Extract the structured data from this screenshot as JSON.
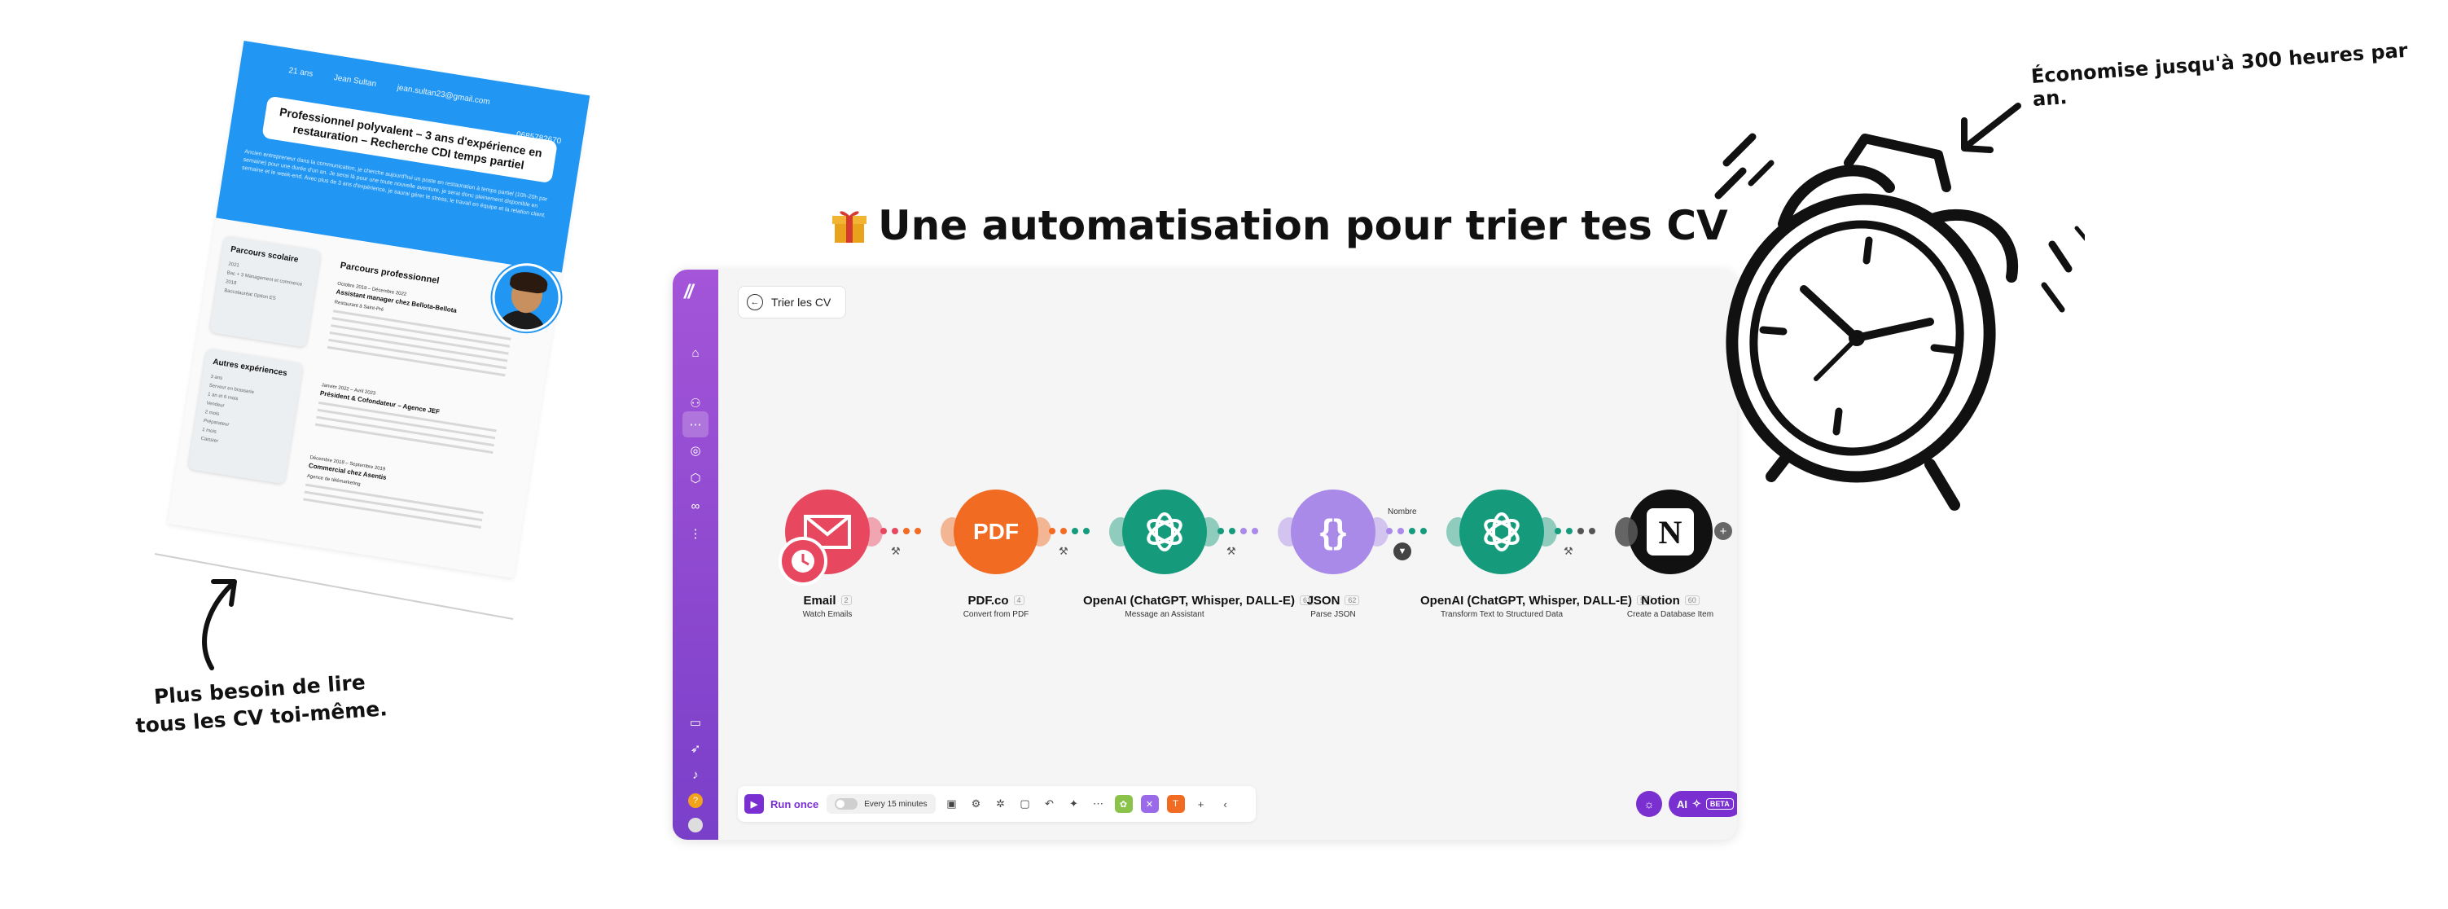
{
  "cv": {
    "age": "21 ans",
    "name": "Jean Sultan",
    "email": "jean.sultan23@gmail.com",
    "phone": "0685782670",
    "headline": "Professionnel polyvalent – 3 ans d'expérience en restauration – Recherche CDI temps partiel",
    "summary": "Ancien entrepreneur dans la communication, je cherche aujourd'hui un poste en restauration à temps partiel (10h-20h par semaine) pour une durée d'un an. Je serai là pour une toute nouvelle aventure, je serai donc pleinement disponible en semaine et le week-end. Avec plus de 3 ans d'expérience, je saurai gérer le stress, le travail en équipe et la relation client.",
    "school_title": "Parcours scolaire",
    "school_lines": [
      "2021",
      "Bac + 3 Management et commerce",
      "2018",
      "Baccalauréat Option ES"
    ],
    "other_title": "Autres expériences",
    "other_lines": [
      "3 ans",
      "Serveur en brasserie",
      "1 an et 6 mois",
      "Vendeur",
      "2 mois",
      "Préparateur",
      "1 mois",
      "Caissier"
    ],
    "pro_title": "Parcours professionnel",
    "jobs": [
      {
        "dates": "Octobre 2019 – Décembre 2022",
        "title": "Assistant manager chez Bellota-Bellota",
        "place": "Restaurant à Saint-Pré"
      },
      {
        "dates": "Janvier 2022 – Avril 2023",
        "title": "Président & Cofondateur – Agence JEF",
        "place": ""
      },
      {
        "dates": "Décembre 2018 – Septembre 2019",
        "title": "Commercial chez Asentis",
        "place": "Agence de télémarketing"
      }
    ]
  },
  "cv_note": {
    "line1": "Plus besoin de lire",
    "line2": "tous les CV toi-même."
  },
  "title": "Une automatisation pour trier tes CV",
  "clock_note": "Économise jusqu'à 300 heures par an.",
  "scenario": {
    "name": "Trier les CV",
    "modules": [
      {
        "name": "Email",
        "index": "2",
        "sub": "Watch Emails",
        "color": "#e8485f"
      },
      {
        "name": "PDF.co",
        "index": "4",
        "sub": "Convert from PDF",
        "color": "#f26b22",
        "icon_text": "PDF"
      },
      {
        "name": "OpenAI (ChatGPT, Whisper, DALL-E)",
        "index": "61",
        "sub": "Message an Assistant",
        "color": "#159b7c"
      },
      {
        "name": "JSON",
        "index": "62",
        "sub": "Parse JSON",
        "color": "#a98ae8",
        "icon_text": "{}"
      },
      {
        "name": "OpenAI (ChatGPT, Whisper, DALL-E)",
        "index": "58",
        "sub": "Transform Text to Structured Data",
        "color": "#159b7c"
      },
      {
        "name": "Notion",
        "index": "60",
        "sub": "Create a Database Item",
        "color": "#111111",
        "icon_text": "N"
      }
    ],
    "route_label": "Nombre",
    "run_label": "Run once",
    "schedule_label": "Every 15 minutes",
    "ai_label": "AI",
    "beta_label": "BETA"
  },
  "colors": {
    "rail_top": "#a455d8",
    "rail_bottom": "#7a3fc9",
    "accent": "#7a2fd0",
    "cv_blue": "#2196f3"
  }
}
